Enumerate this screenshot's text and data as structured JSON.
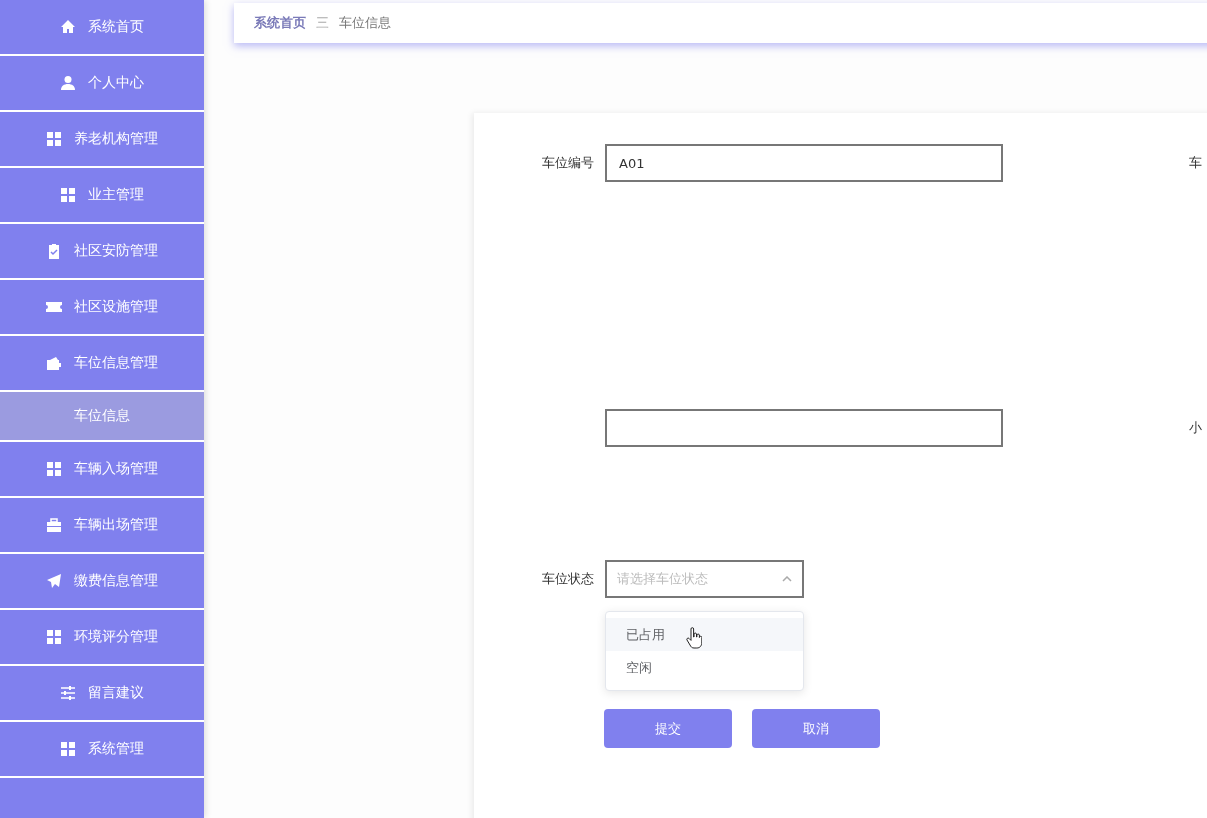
{
  "sidebar": {
    "items": [
      {
        "label": "系统首页",
        "selected": false
      },
      {
        "label": "个人中心",
        "selected": false
      },
      {
        "label": "养老机构管理",
        "selected": false
      },
      {
        "label": "业主管理",
        "selected": false
      },
      {
        "label": "社区安防管理",
        "selected": false
      },
      {
        "label": "社区设施管理",
        "selected": false
      },
      {
        "label": "车位信息管理",
        "selected": false,
        "expanded": true,
        "children": [
          {
            "label": "车位信息",
            "selected": true
          }
        ]
      },
      {
        "label": "车辆入场管理",
        "selected": false
      },
      {
        "label": "车辆出场管理",
        "selected": false
      },
      {
        "label": "缴费信息管理",
        "selected": false
      },
      {
        "label": "环境评分管理",
        "selected": false
      },
      {
        "label": "留言建议",
        "selected": false
      },
      {
        "label": "系统管理",
        "selected": false
      }
    ]
  },
  "breadcrumb": {
    "items": [
      "系统首页",
      "车位信息"
    ],
    "separator": "三"
  },
  "form": {
    "rows": [
      {
        "left": {
          "label": "车位编号",
          "value": "A01"
        },
        "right": {
          "label": "车"
        }
      },
      {
        "left": {},
        "right": {
          "label": "小"
        }
      }
    ],
    "select": {
      "label": "车位状态",
      "placeholder": "请选择车位状态",
      "expanded": true,
      "options": [
        {
          "label": "已占用",
          "highlighted": true,
          "selected": false
        },
        {
          "label": "空闲",
          "highlighted": false,
          "selected": false
        }
      ]
    },
    "buttons": [
      "提交",
      "取消"
    ]
  }
}
